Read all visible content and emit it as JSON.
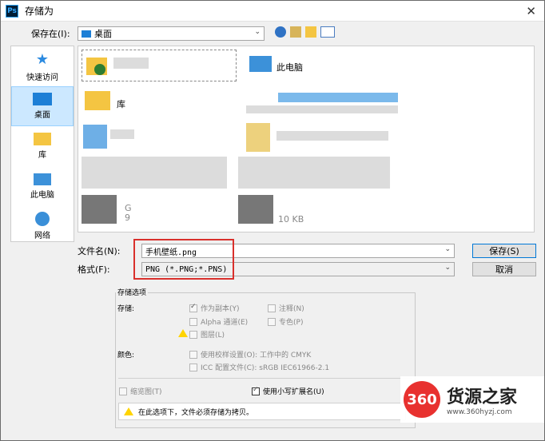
{
  "window": {
    "title": "存储为",
    "app_icon": "Ps"
  },
  "save_in": {
    "label": "保存在(I):",
    "value": "桌面"
  },
  "places": [
    {
      "label": "快速访问",
      "icon": "star-icon"
    },
    {
      "label": "桌面",
      "icon": "desktop-icon",
      "selected": true
    },
    {
      "label": "库",
      "icon": "library-icon"
    },
    {
      "label": "此电脑",
      "icon": "computer-icon"
    },
    {
      "label": "网络",
      "icon": "network-icon"
    }
  ],
  "files": {
    "this_pc": "此电脑",
    "library": "库",
    "size_text": "10 KB",
    "partial_digits": [
      "G",
      "9"
    ]
  },
  "filename": {
    "label": "文件名(N):",
    "value": "手机壁纸.png"
  },
  "format": {
    "label": "格式(F):",
    "value": "PNG (*.PNG;*.PNS)"
  },
  "buttons": {
    "save": "保存(S)",
    "cancel": "取消"
  },
  "options": {
    "legend": "存储选项",
    "save_label": "存储:",
    "as_copy": "作为副本(Y)",
    "notes": "注释(N)",
    "alpha": "Alpha 通道(E)",
    "spot": "专色(P)",
    "layers": "图层(L)",
    "color_label": "颜色:",
    "proof": "使用校样设置(O): 工作中的 CMYK",
    "icc": "ICC 配置文件(C): sRGB IEC61966-2.1",
    "thumbnail": "缩览图(T)",
    "lowercase_ext": "使用小写扩展名(U)",
    "warning": "在此选项下，文件必须存储为拷贝。"
  },
  "watermark": {
    "logo": "360",
    "name": "货源之家",
    "url": "www.360hyzj.com"
  }
}
